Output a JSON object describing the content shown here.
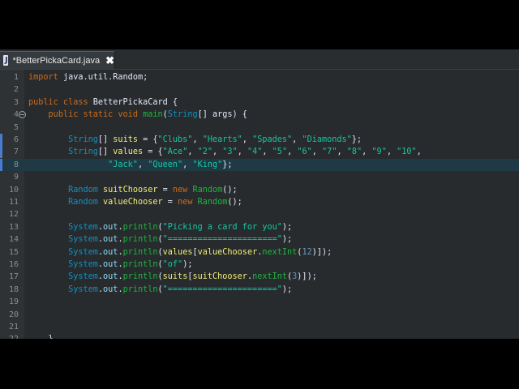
{
  "tab": {
    "title": "*BetterPickaCard.java",
    "icon_name": "java-file-icon",
    "close_glyph": "✖",
    "icon_letter": "J"
  },
  "colors": {
    "editor_bg": "#272b2d",
    "keyword": "#cc6c1d",
    "string": "#17c6a3",
    "type": "#1290c3",
    "method": "#1eb540",
    "highlight_line": "#1f3a44"
  },
  "highlighted_line": 8,
  "lines": [
    {
      "n": "1",
      "tokens": [
        [
          "kw",
          "import"
        ],
        [
          "op",
          " java.util.Random;"
        ]
      ]
    },
    {
      "n": "2",
      "tokens": []
    },
    {
      "n": "3",
      "tokens": [
        [
          "kw",
          "public class"
        ],
        [
          "op",
          " BetterPickaCard {"
        ]
      ]
    },
    {
      "n": "4",
      "tokens": [
        [
          "op",
          "    "
        ],
        [
          "kw",
          "public static void"
        ],
        [
          "op",
          " "
        ],
        [
          "fn",
          "main"
        ],
        [
          "op",
          "("
        ],
        [
          "ty",
          "String"
        ],
        [
          "op",
          "[] args) {"
        ]
      ]
    },
    {
      "n": "5",
      "tokens": []
    },
    {
      "n": "6",
      "tokens": [
        [
          "op",
          "        "
        ],
        [
          "ty",
          "String"
        ],
        [
          "op",
          "[] "
        ],
        [
          "vr",
          "suits"
        ],
        [
          "op",
          " = {"
        ],
        [
          "st",
          "\"Clubs\""
        ],
        [
          "op",
          ", "
        ],
        [
          "st",
          "\"Hearts\""
        ],
        [
          "op",
          ", "
        ],
        [
          "st",
          "\"Spades\""
        ],
        [
          "op",
          ", "
        ],
        [
          "st",
          "\"Diamonds\""
        ],
        [
          "op",
          "};"
        ]
      ]
    },
    {
      "n": "7",
      "tokens": [
        [
          "op",
          "        "
        ],
        [
          "ty",
          "String"
        ],
        [
          "op",
          "[] "
        ],
        [
          "vr",
          "values"
        ],
        [
          "op",
          " = {"
        ],
        [
          "st",
          "\"Ace\""
        ],
        [
          "op",
          ", "
        ],
        [
          "st",
          "\"2\""
        ],
        [
          "op",
          ", "
        ],
        [
          "st",
          "\"3\""
        ],
        [
          "op",
          ", "
        ],
        [
          "st",
          "\"4\""
        ],
        [
          "op",
          ", "
        ],
        [
          "st",
          "\"5\""
        ],
        [
          "op",
          ", "
        ],
        [
          "st",
          "\"6\""
        ],
        [
          "op",
          ", "
        ],
        [
          "st",
          "\"7\""
        ],
        [
          "op",
          ", "
        ],
        [
          "st",
          "\"8\""
        ],
        [
          "op",
          ", "
        ],
        [
          "st",
          "\"9\""
        ],
        [
          "op",
          ", "
        ],
        [
          "st",
          "\"10\""
        ],
        [
          "op",
          ","
        ]
      ]
    },
    {
      "n": "8",
      "tokens": [
        [
          "op",
          "                "
        ],
        [
          "st",
          "\"Jack\""
        ],
        [
          "op",
          ", "
        ],
        [
          "st",
          "\"Queen\""
        ],
        [
          "op",
          ", "
        ],
        [
          "st",
          "\"King\""
        ],
        [
          "op",
          "};"
        ]
      ]
    },
    {
      "n": "9",
      "tokens": []
    },
    {
      "n": "10",
      "tokens": [
        [
          "op",
          "        "
        ],
        [
          "ty",
          "Random"
        ],
        [
          "op",
          " "
        ],
        [
          "vr",
          "suitChooser"
        ],
        [
          "op",
          " = "
        ],
        [
          "kw",
          "new"
        ],
        [
          "op",
          " "
        ],
        [
          "fn",
          "Random"
        ],
        [
          "op",
          "();"
        ]
      ]
    },
    {
      "n": "11",
      "tokens": [
        [
          "op",
          "        "
        ],
        [
          "ty",
          "Random"
        ],
        [
          "op",
          " "
        ],
        [
          "vr",
          "valueChooser"
        ],
        [
          "op",
          " = "
        ],
        [
          "kw",
          "new"
        ],
        [
          "op",
          " "
        ],
        [
          "fn",
          "Random"
        ],
        [
          "op",
          "();"
        ]
      ]
    },
    {
      "n": "12",
      "tokens": []
    },
    {
      "n": "13",
      "tokens": [
        [
          "op",
          "        "
        ],
        [
          "ty",
          "System"
        ],
        [
          "op",
          "."
        ],
        [
          "fd",
          "out"
        ],
        [
          "op",
          "."
        ],
        [
          "fn",
          "println"
        ],
        [
          "op",
          "("
        ],
        [
          "st",
          "\"Picking a card for you\""
        ],
        [
          "op",
          ");"
        ]
      ]
    },
    {
      "n": "14",
      "tokens": [
        [
          "op",
          "        "
        ],
        [
          "ty",
          "System"
        ],
        [
          "op",
          "."
        ],
        [
          "fd",
          "out"
        ],
        [
          "op",
          "."
        ],
        [
          "fn",
          "println"
        ],
        [
          "op",
          "("
        ],
        [
          "st",
          "\"======================\""
        ],
        [
          "op",
          ");"
        ]
      ]
    },
    {
      "n": "15",
      "tokens": [
        [
          "op",
          "        "
        ],
        [
          "ty",
          "System"
        ],
        [
          "op",
          "."
        ],
        [
          "fd",
          "out"
        ],
        [
          "op",
          "."
        ],
        [
          "fn",
          "println"
        ],
        [
          "op",
          "("
        ],
        [
          "vr",
          "values"
        ],
        [
          "op",
          "["
        ],
        [
          "vr",
          "valueChooser"
        ],
        [
          "op",
          "."
        ],
        [
          "fn",
          "nextInt"
        ],
        [
          "op",
          "("
        ],
        [
          "nu",
          "12"
        ],
        [
          "op",
          ")]);"
        ]
      ]
    },
    {
      "n": "16",
      "tokens": [
        [
          "op",
          "        "
        ],
        [
          "ty",
          "System"
        ],
        [
          "op",
          "."
        ],
        [
          "fd",
          "out"
        ],
        [
          "op",
          "."
        ],
        [
          "fn",
          "println"
        ],
        [
          "op",
          "("
        ],
        [
          "st",
          "\"of\""
        ],
        [
          "op",
          ");"
        ]
      ]
    },
    {
      "n": "17",
      "tokens": [
        [
          "op",
          "        "
        ],
        [
          "ty",
          "System"
        ],
        [
          "op",
          "."
        ],
        [
          "fd",
          "out"
        ],
        [
          "op",
          "."
        ],
        [
          "fn",
          "println"
        ],
        [
          "op",
          "("
        ],
        [
          "vr",
          "suits"
        ],
        [
          "op",
          "["
        ],
        [
          "vr",
          "suitChooser"
        ],
        [
          "op",
          "."
        ],
        [
          "fn",
          "nextInt"
        ],
        [
          "op",
          "("
        ],
        [
          "nu",
          "3"
        ],
        [
          "op",
          ")]);"
        ]
      ]
    },
    {
      "n": "18",
      "tokens": [
        [
          "op",
          "        "
        ],
        [
          "ty",
          "System"
        ],
        [
          "op",
          "."
        ],
        [
          "fd",
          "out"
        ],
        [
          "op",
          "."
        ],
        [
          "fn",
          "println"
        ],
        [
          "op",
          "("
        ],
        [
          "st",
          "\"======================\""
        ],
        [
          "op",
          ");"
        ]
      ]
    },
    {
      "n": "19",
      "tokens": []
    },
    {
      "n": "20",
      "tokens": []
    },
    {
      "n": "21",
      "tokens": []
    },
    {
      "n": "22",
      "tokens": [
        [
          "op",
          "    }"
        ]
      ]
    }
  ]
}
